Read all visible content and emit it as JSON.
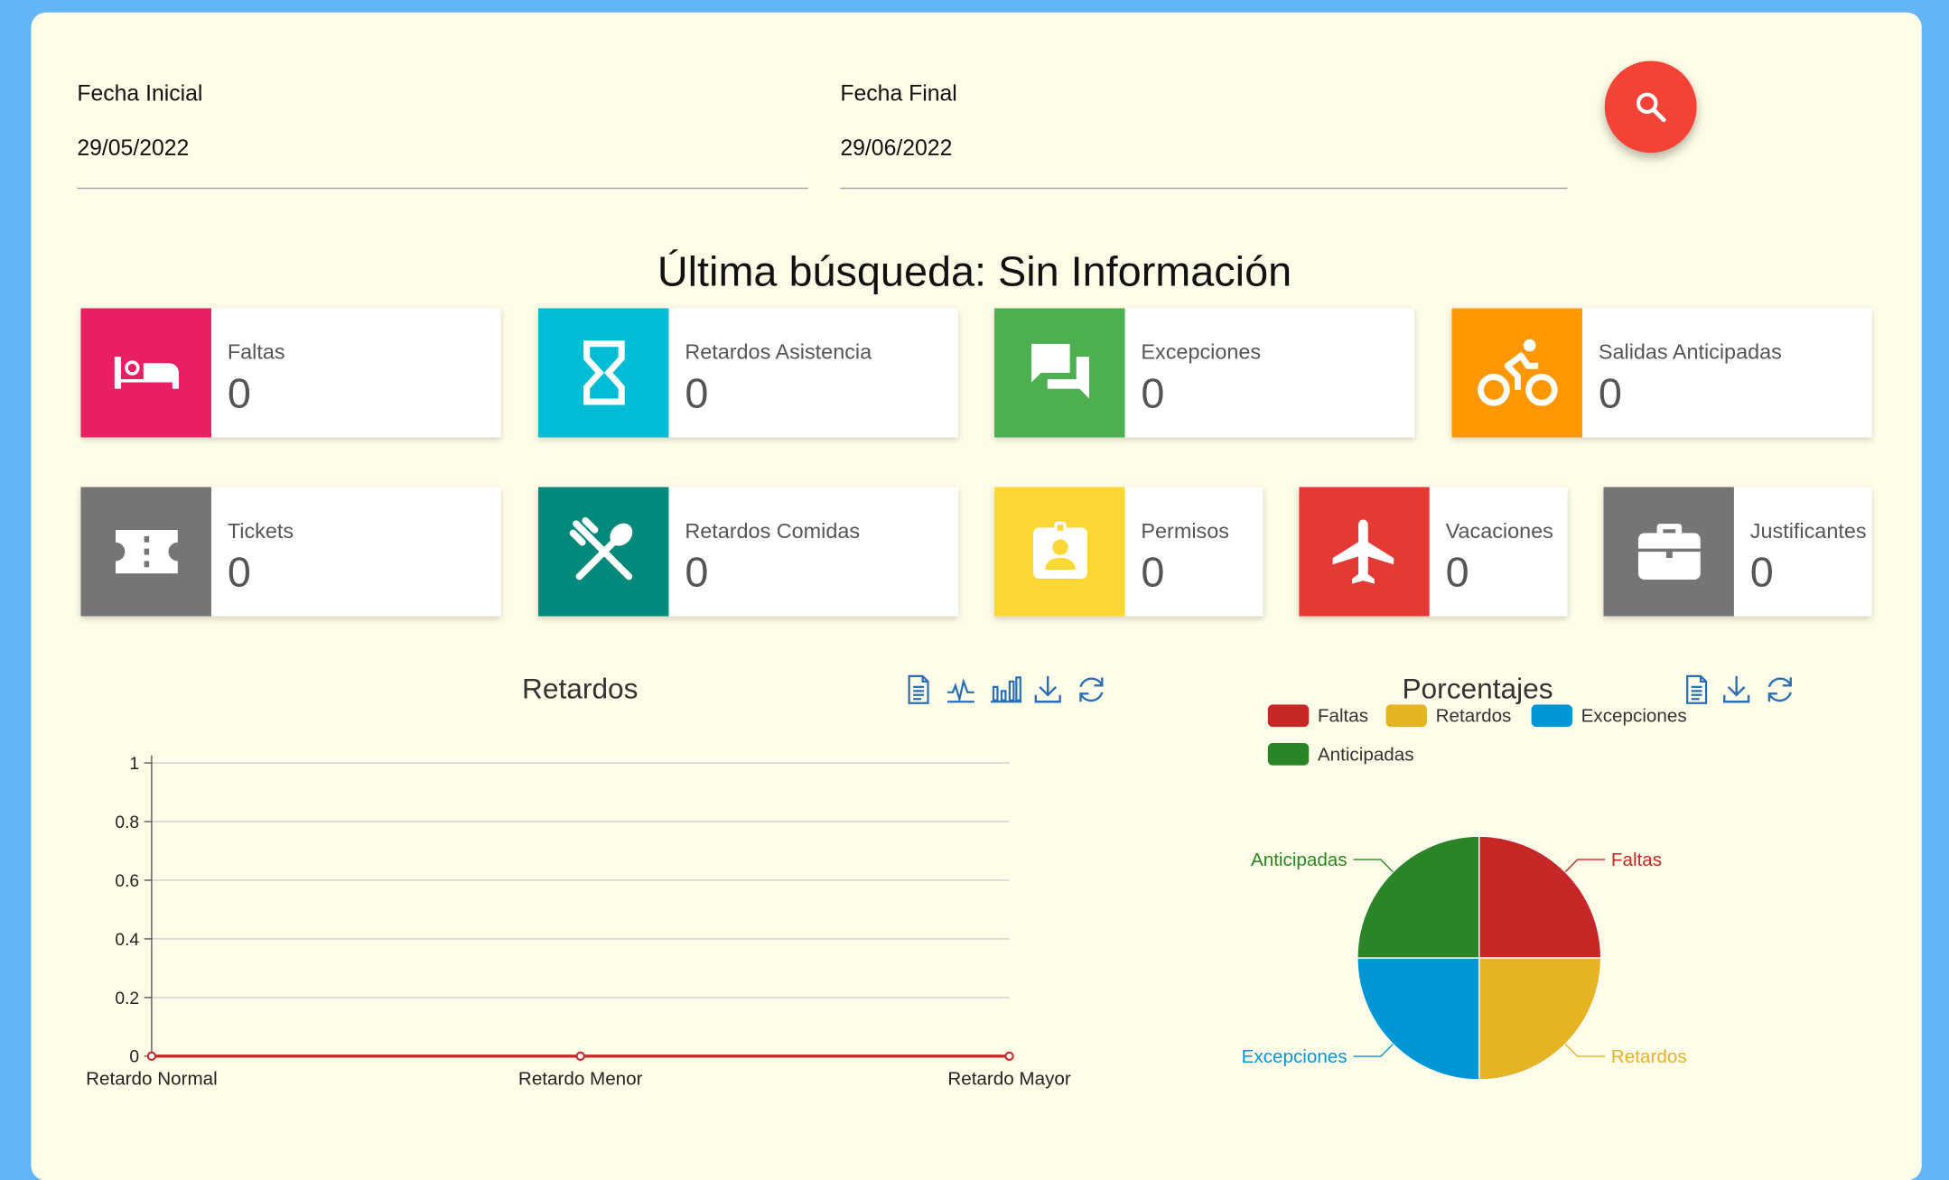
{
  "filters": {
    "start": {
      "label": "Fecha Inicial",
      "value": "29/05/2022"
    },
    "end": {
      "label": "Fecha Final",
      "value": "29/06/2022"
    }
  },
  "search_icon": "search-icon",
  "headline": "Última búsqueda: Sin Información",
  "tiles": [
    {
      "label": "Faltas",
      "value": "0",
      "color": "#e91e63",
      "icon": "bed-icon"
    },
    {
      "label": "Retardos Asistencia",
      "value": "0",
      "color": "#00bcd4",
      "icon": "hourglass-icon"
    },
    {
      "label": "Excepciones",
      "value": "0",
      "color": "#4caf50",
      "icon": "chat-icon"
    },
    {
      "label": "Salidas Anticipadas",
      "value": "0",
      "color": "#ff9800",
      "icon": "bike-icon"
    },
    {
      "label": "Tickets",
      "value": "0",
      "color": "#757575",
      "icon": "ticket-icon"
    },
    {
      "label": "Retardos Comidas",
      "value": "0",
      "color": "#00897b",
      "icon": "utensils-icon"
    },
    {
      "label": "Permisos",
      "value": "0",
      "color": "#fdd835",
      "icon": "badge-icon"
    },
    {
      "label": "Vacaciones",
      "value": "0",
      "color": "#e53935",
      "icon": "plane-icon"
    },
    {
      "label": "Justificantes",
      "value": "0",
      "color": "#757575",
      "icon": "briefcase-icon"
    }
  ],
  "retardos_chart": {
    "title": "Retardos",
    "toolbar": [
      "document-icon",
      "line-chart-icon",
      "bar-chart-icon",
      "download-icon",
      "refresh-icon"
    ]
  },
  "porcentajes_chart": {
    "title": "Porcentajes",
    "toolbar": [
      "document-icon",
      "download-icon",
      "refresh-icon"
    ]
  },
  "chart_data": [
    {
      "type": "line",
      "title": "Retardos",
      "categories": [
        "Retardo Normal",
        "Retardo Menor",
        "Retardo Mayor"
      ],
      "values": [
        0,
        0,
        0
      ],
      "yticks": [
        "0",
        "0.2",
        "0.4",
        "0.6",
        "0.8",
        "1"
      ],
      "ylim": [
        0,
        1
      ],
      "grid": true,
      "color": "#c62828"
    },
    {
      "type": "pie",
      "title": "Porcentajes",
      "labels": [
        "Faltas",
        "Retardos",
        "Excepciones",
        "Anticipadas"
      ],
      "values": [
        1,
        1,
        1,
        1
      ],
      "colors": [
        "#c62828",
        "#e6b325",
        "#0096d6",
        "#2a8526"
      ],
      "legend": "top"
    }
  ]
}
